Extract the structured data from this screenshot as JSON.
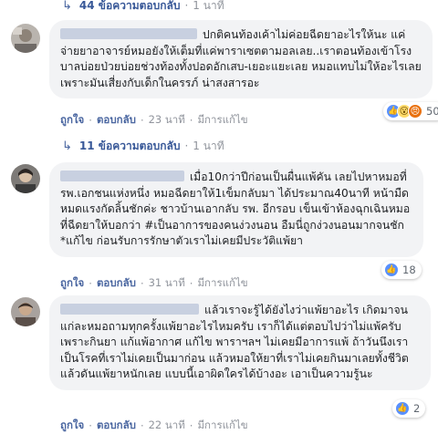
{
  "thread1": {
    "reply_count": "44 ข้อความตอบกลับ",
    "time": "1 นาที"
  },
  "comment1": {
    "text": "ปกติคนท้องเค้าไม่ค่อยฉีดยาอะไรให้นะ แค่จ่ายยาอาจารย์หมอยังให้เต็มที่แค่พาราเซตตามอลเลย..เราตอนท้องเข้าโรงบาลบ่อยป่วยบ่อยช่วงท้องทั้งปอดอักเสบ-เยอะแยะเลย หมอแทบไม่ให้อะไรเลยเพราะมันเสี่ยงกับเด็กในครรภ์ น่าสงสารอะ",
    "like": "ถูกใจ",
    "reply": "ตอบกลับ",
    "time": "23 นาที",
    "edited": "มีการแก้ไข",
    "reaction_count": "50"
  },
  "thread2": {
    "reply_count": "11 ข้อความตอบกลับ",
    "time": "1 นาที"
  },
  "comment2": {
    "text_before": "เมื่อ10กว่าปีก่อนเป็นผื่นแพ้คัน เลยไปหาหมอที่ รพ.เอกชนแห่งหนึ่ง หมอฉีดยาให้1เข็มกลับมา ได้ประมาณ40นาที หน้ามืดหมดแรงกัดลิ้นชักค่ะ ชาวบ้านเอากลับ รพ. อีกรอบ เข็นเข้าห้องฉุกเฉินหมอที่ฉีดยาให้บอกว่า ",
    "hashtag": "#เป็นอาการของคนง่วงนอน",
    "text_after": " อืมนี่ถูกง่วงนอนมากจนชัก *แก้ไข ก่อนรับการรักษาตัวเราไม่เคยมีประวัติแพ้ยา",
    "like": "ถูกใจ",
    "reply": "ตอบกลับ",
    "time": "31 นาที",
    "edited": "มีการแก้ไข",
    "reaction_count": "18"
  },
  "comment3": {
    "text": "แล้วเราจะรู้ได้ยังไงว่าแพ้ยาอะไร เกิดมาจนแก่ละหมอถามทุกครั้งแพ้ยาอะไรไหมครับ เราก็ได้แต่ตอบไปว่าไม่แพ้ครับ เพราะกินยา แก้แพ้อากาศ แก้ไข พาราฯลฯ ไม่เคยมีอาการแพ้ ถ้าวันนึงเราเป็นโรคที่เราไม่เคยเป็นมาก่อน แล้วหมอให้ยาที่เราไม่เคยกินมาเลยทั้งชีวิตแล้วดันแพ้ยาหนักเลย แบบนี้เอาผิดใครได้บ้างอะ เอาเป็นความรู้นะ",
    "like": "ถูกใจ",
    "reply": "ตอบกลับ",
    "time": "22 นาที",
    "edited": "มีการแก้ไข",
    "reaction_count": "2"
  },
  "colors": {
    "link": "#385898",
    "bubble": "#f2f3f5",
    "like_blue": "#5890ff"
  }
}
